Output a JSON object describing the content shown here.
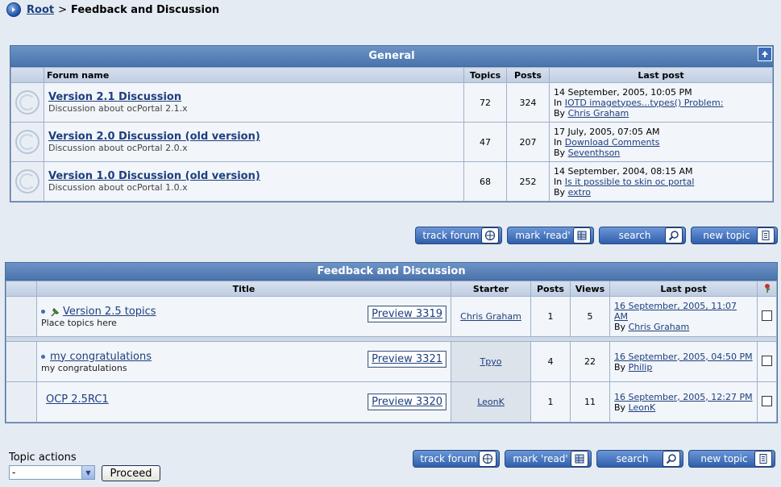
{
  "breadcrumb": {
    "root": "Root",
    "separator": ">",
    "current": "Feedback and Discussion"
  },
  "general": {
    "title": "General",
    "headers": [
      "Forum name",
      "Topics",
      "Posts",
      "Last post"
    ],
    "forums": [
      {
        "name": "Version 2.1 Discussion",
        "desc": "Discussion about ocPortal 2.1.x",
        "topics": "72",
        "posts": "324",
        "date": "14 September, 2005, 10:05 PM",
        "in_prefix": "In",
        "in": "IOTD imagetypes...types() Problem:",
        "by_prefix": "By",
        "by": "Chris Graham"
      },
      {
        "name": "Version 2.0 Discussion (old version)",
        "desc": "Discussion about ocPortal 2.0.x",
        "topics": "47",
        "posts": "207",
        "date": "17 July, 2005, 07:05 AM",
        "in_prefix": "In",
        "in": "Download Comments",
        "by_prefix": "By",
        "by": "Seventhson"
      },
      {
        "name": "Version 1.0 Discussion (old version)",
        "desc": "Discussion about ocPortal 1.0.x",
        "topics": "68",
        "posts": "252",
        "date": "14 September, 2004, 08:15 AM",
        "in_prefix": "In",
        "in": "Is it possible to skin oc portal",
        "by_prefix": "By",
        "by": "extro"
      }
    ]
  },
  "buttons": {
    "track": "track forum",
    "mark": "mark 'read'",
    "search": "search",
    "new_topic": "new topic"
  },
  "feedback": {
    "title": "Feedback and Discussion",
    "headers": [
      "Title",
      "Starter",
      "Posts",
      "Views",
      "Last post"
    ],
    "topics": [
      {
        "title": "Version 2.5 topics",
        "sub": "Place topics here",
        "preview": "Preview 3319",
        "starter": "Chris Graham",
        "posts": "1",
        "views": "5",
        "last_date": "16 September, 2005, 11:07 AM",
        "by_prefix": "By",
        "by": "Chris Graham"
      },
      {
        "title": "my congratulations",
        "sub": "my congratulations",
        "preview": "Preview 3321",
        "starter": "Tpyo",
        "posts": "4",
        "views": "22",
        "last_date": "16 September, 2005, 04:50 PM",
        "by_prefix": "By",
        "by": "Philip"
      },
      {
        "title": "OCP 2.5RC1",
        "sub": "",
        "preview": "Preview 3320",
        "starter": "LeonK",
        "posts": "1",
        "views": "11",
        "last_date": "16 September, 2005, 12:27 PM",
        "by_prefix": "By",
        "by": "LeonK"
      }
    ]
  },
  "topic_actions": {
    "label": "Topic actions",
    "selected": "-",
    "proceed": "Proceed"
  }
}
